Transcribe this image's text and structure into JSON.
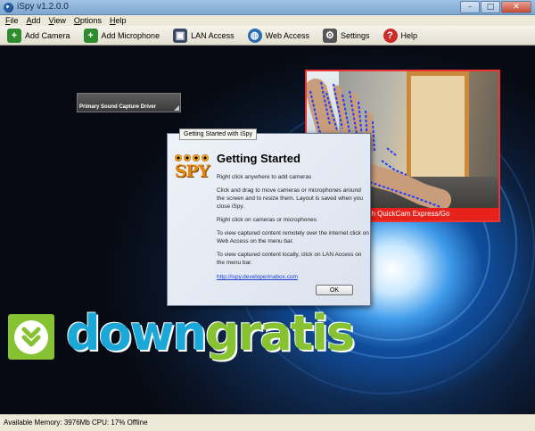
{
  "window": {
    "title": "iSpy v1.2.0.0",
    "buttons": {
      "minimize": "–",
      "maximize": "□",
      "close": "✕"
    }
  },
  "menu": [
    "File",
    "Add",
    "View",
    "Options",
    "Help"
  ],
  "toolbar": [
    {
      "label": "Add Camera",
      "icon": "camera-icon",
      "color": "#2e8b2e"
    },
    {
      "label": "Add Microphone",
      "icon": "microphone-icon",
      "color": "#2e8b2e"
    },
    {
      "label": "LAN Access",
      "icon": "lan-icon",
      "color": "#3a4a66"
    },
    {
      "label": "Web Access",
      "icon": "globe-icon",
      "color": "#2b6cb0"
    },
    {
      "label": "Settings",
      "icon": "gear-icon",
      "color": "#555555"
    },
    {
      "label": "Help",
      "icon": "help-icon",
      "color": "#cc2b2b"
    }
  ],
  "audio_source": {
    "label": "Primary Sound Capture Driver"
  },
  "dialog": {
    "tab": "Getting Started with iSpy",
    "logo_text": "SPY",
    "heading": "Getting Started",
    "paragraphs": [
      "Right click anywhere to add cameras",
      "Click and drag to move cameras or microphones around the screen and to resize them. Layout is saved when you close iSpy.",
      "Right click on cameras or microphones",
      "To view captured content remotely over the internet click on Web Access on the menu bar.",
      "To view captured content locally, click on LAN Access on the menu bar."
    ],
    "link": "http://ispy.developerinabox.com",
    "ok": "OK"
  },
  "camera": {
    "status": "11.48 FPS, Logitech QuickCam Express/Go",
    "border_color": "#e33333"
  },
  "watermark": {
    "part1": "down",
    "part2": "gratis"
  },
  "statusbar": {
    "text": "Available Memory: 3976Mb CPU: 17% Offline"
  }
}
